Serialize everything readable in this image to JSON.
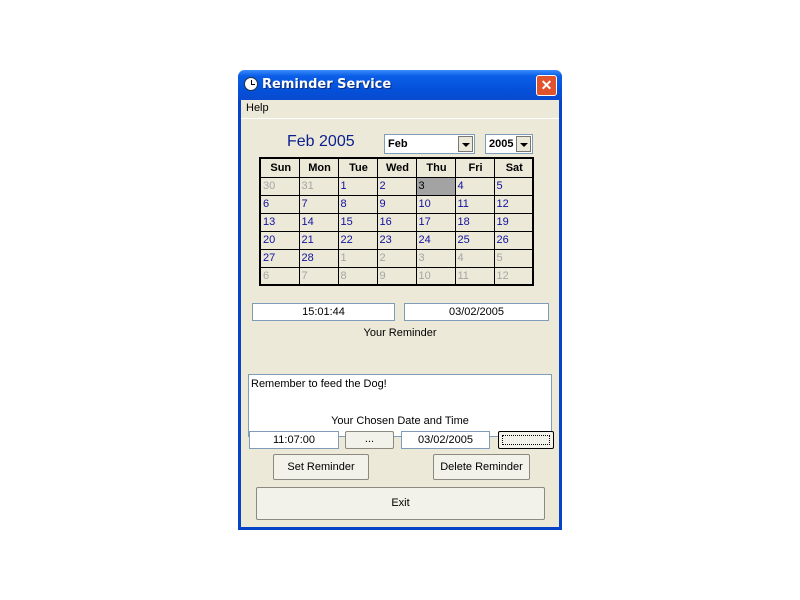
{
  "window": {
    "title": "Reminder Service",
    "close_glyph": "✕"
  },
  "menu": {
    "help": "Help"
  },
  "calendar": {
    "month_title": "Feb 2005",
    "month_select": "Feb",
    "year_select": "2005",
    "weekdays": [
      "Sun",
      "Mon",
      "Tue",
      "Wed",
      "Thu",
      "Fri",
      "Sat"
    ],
    "weeks": [
      [
        "30",
        "31",
        "1",
        "2",
        "3",
        "4",
        "5"
      ],
      [
        "6",
        "7",
        "8",
        "9",
        "10",
        "11",
        "12"
      ],
      [
        "13",
        "14",
        "15",
        "16",
        "17",
        "18",
        "19"
      ],
      [
        "20",
        "21",
        "22",
        "23",
        "24",
        "25",
        "26"
      ],
      [
        "27",
        "28",
        "1",
        "2",
        "3",
        "4",
        "5"
      ],
      [
        "6",
        "7",
        "8",
        "9",
        "10",
        "11",
        "12"
      ]
    ],
    "selected_day": "3"
  },
  "current": {
    "time": "15:01:44",
    "date": "03/02/2005"
  },
  "reminder": {
    "label": "Your Reminder",
    "text": "Remember to feed the Dog!"
  },
  "chosen": {
    "label": "Your Chosen Date and Time",
    "time": "11:07:00",
    "time_picker": "...",
    "date": "03/02/2005",
    "date_picker": ""
  },
  "buttons": {
    "set": "Set Reminder",
    "delete": "Delete Reminder",
    "exit": "Exit"
  }
}
